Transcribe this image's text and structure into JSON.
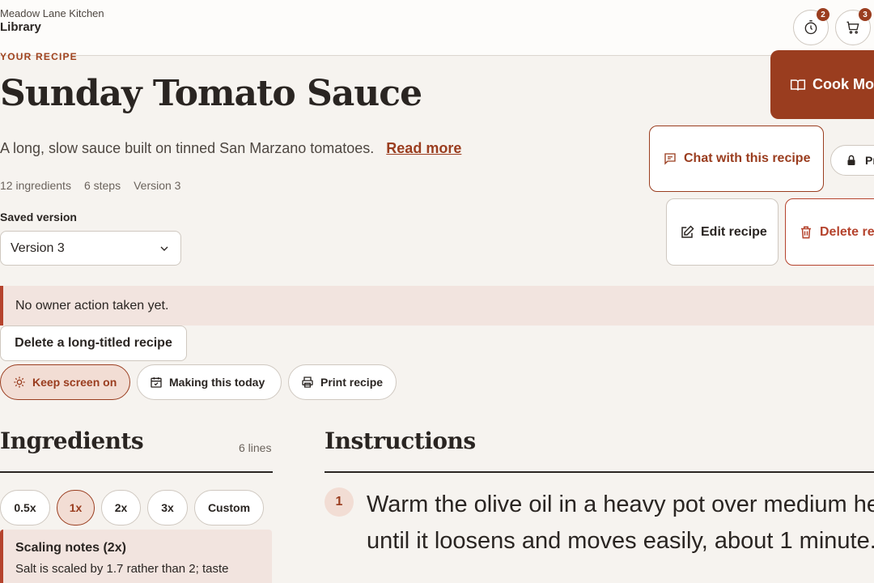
{
  "header": {
    "brand_small": "Meadow Lane Kitchen",
    "brand_main": "Library",
    "timers_count": "2",
    "cart_count": "3"
  },
  "recipe": {
    "eyebrow": "YOUR RECIPE",
    "title": "Sunday Tomato Sauce",
    "description": "A long, slow sauce built on tinned San Marzano tomatoes.",
    "read_more": "Read more",
    "meta": [
      "12 ingredients",
      "6 steps",
      "Version 3"
    ],
    "saved_version_label": "Saved version",
    "saved_version_value": "Version 3"
  },
  "actions": {
    "cook_mode": "Cook Mo",
    "chat": "Chat with this recipe",
    "private": "Pr",
    "edit": "Edit recipe",
    "delete": "Delete re"
  },
  "notice": "No owner action taken yet.",
  "delete_long_button": "Delete a long-titled recipe",
  "toggles": {
    "keep_screen": "Keep screen on",
    "making_today": "Making this today",
    "print": "Print recipe"
  },
  "ingredients": {
    "heading": "Ingredients",
    "count": "6 lines",
    "scales": [
      "0.5x",
      "1x",
      "2x",
      "3x",
      "Custom"
    ],
    "active_scale": "1x",
    "notes_title": "Scaling notes (2x)",
    "notes_body": "Salt is scaled by 1.7 rather than 2; taste"
  },
  "instructions": {
    "heading": "Instructions",
    "step_number": "1",
    "step_text": "Warm the olive oil in a heavy pot over medium heat until it loosens and moves easily, about 1 minute."
  },
  "colors": {
    "accent": "#9a3d1f",
    "danger": "#b5432d",
    "background": "#f6f3ef",
    "notice_bg": "#f2e4df"
  }
}
